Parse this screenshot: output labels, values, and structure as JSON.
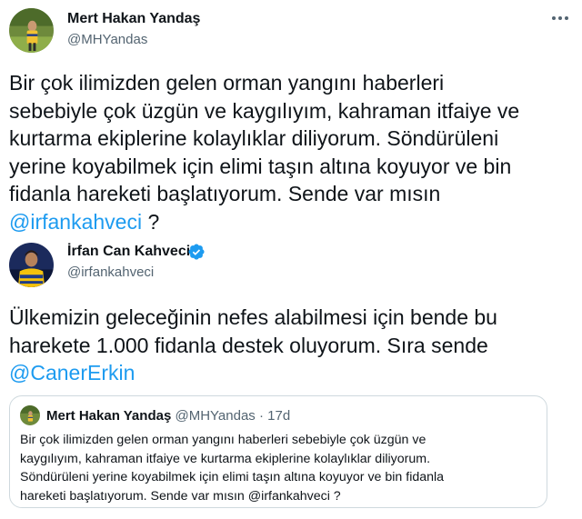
{
  "tweet1": {
    "author_name": "Mert Hakan Yandaş",
    "author_handle": "@MHYandas",
    "text_lines": [
      "Bir çok ilimizden gelen orman yangını haberleri",
      "sebebiyle çok üzgün ve kaygılıyım, kahraman itfaiye ve",
      "kurtarma ekiplerine kolaylıklar diliyorum. Söndürüleni",
      "yerine koyabilmek için elimi taşın altına koyuyor ve bin",
      "fidanla hareketi başlatıyorum. Sende var mısın"
    ],
    "mention": "@irfankahveci",
    "trailing": " ?"
  },
  "tweet2": {
    "author_name": "İrfan Can Kahveci",
    "author_handle": "@irfankahveci",
    "text_lines": [
      "Ülkemizin geleceğinin nefes alabilmesi için bende bu",
      "harekete 1.000 fidanla destek oluyorum. Sıra sende"
    ],
    "mention": "@CanerErkin",
    "quote": {
      "author_name": "Mert Hakan Yandaş",
      "author_handle": "@MHYandas",
      "separator": "·",
      "time": "17d",
      "text_lines": [
        "Bir çok ilimizden gelen orman yangını haberleri sebebiyle çok üzgün ve",
        "kaygılıyım, kahraman itfaiye ve kurtarma ekiplerine kolaylıklar diliyorum.",
        "Söndürüleni yerine koyabilmek için elimi taşın altına koyuyor ve bin fidanla",
        "hareketi başlatıyorum. Sende var mısın @irfankahveci ?"
      ]
    }
  },
  "icons": {
    "more": "more-horizontal-icon",
    "verified": "verified-badge-icon"
  },
  "colors": {
    "text": "#0f1419",
    "secondary": "#536471",
    "link": "#1d9bf0",
    "border": "#cfd9de"
  }
}
